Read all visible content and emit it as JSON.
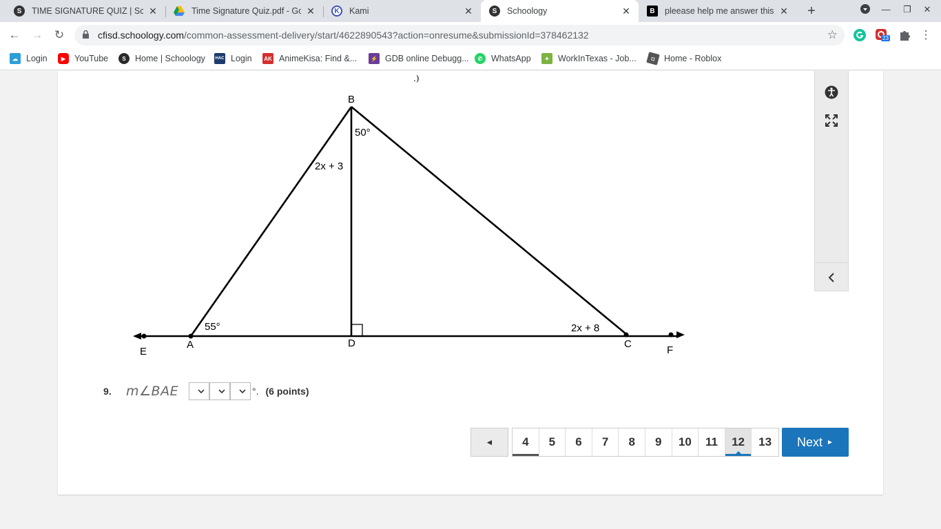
{
  "browser": {
    "tabs": [
      {
        "title": "TIME SIGNATURE QUIZ | Schoology",
        "icon": "schoology-icon",
        "active": false
      },
      {
        "title": "Time Signature Quiz.pdf - Google Drive",
        "icon": "google-drive-icon",
        "active": false
      },
      {
        "title": "Kami",
        "icon": "kami-icon",
        "active": false
      },
      {
        "title": "Schoology",
        "icon": "schoology-icon",
        "active": true
      },
      {
        "title": "pleease help me answer this question",
        "icon": "brainly-icon",
        "active": false
      }
    ],
    "url_host": "cfisd.schoology.com",
    "url_path": "/common-assessment-delivery/start/4622890543?action=onresume&submissionId=378462132",
    "extension_badge": "23",
    "bookmarks": [
      {
        "label": "Login",
        "icon": "cloud-icon",
        "color": "#2a9fd8"
      },
      {
        "label": "YouTube",
        "icon": "youtube-icon",
        "color": "#ff0000"
      },
      {
        "label": "Home | Schoology",
        "icon": "schoology-icon",
        "color": "#2a2a2a"
      },
      {
        "label": "Login",
        "icon": "hac-icon",
        "color": "#1d3c6e"
      },
      {
        "label": "AnimeKisa: Find &...",
        "icon": "animekisa-icon",
        "color": "#d32f2f"
      },
      {
        "label": "GDB online Debugg...",
        "icon": "gdb-icon",
        "color": "#6a3d9a"
      },
      {
        "label": "WhatsApp",
        "icon": "whatsapp-icon",
        "color": "#25d366"
      },
      {
        "label": "WorkInTexas - Job...",
        "icon": "texas-icon",
        "color": "#7cb342"
      },
      {
        "label": "Home - Roblox",
        "icon": "roblox-icon",
        "color": "#555555"
      }
    ]
  },
  "figure": {
    "labels": {
      "B": "B",
      "A": "A",
      "D": "D",
      "C": "C",
      "E": "E",
      "F": "F",
      "angle_b": "50°",
      "angle_a": "55°",
      "expr_ab": "2x + 3",
      "expr_c": "2x + 8"
    }
  },
  "question": {
    "number": "9.",
    "expression": "m∠BAE",
    "degree": "°.",
    "points": "(6 points)"
  },
  "pagination": {
    "prev_label": "◄",
    "pages": [
      "4",
      "5",
      "6",
      "7",
      "8",
      "9",
      "10",
      "11",
      "12",
      "13"
    ],
    "current": "12",
    "next_label": "Next"
  },
  "colors": {
    "accent": "#1a75bb"
  }
}
